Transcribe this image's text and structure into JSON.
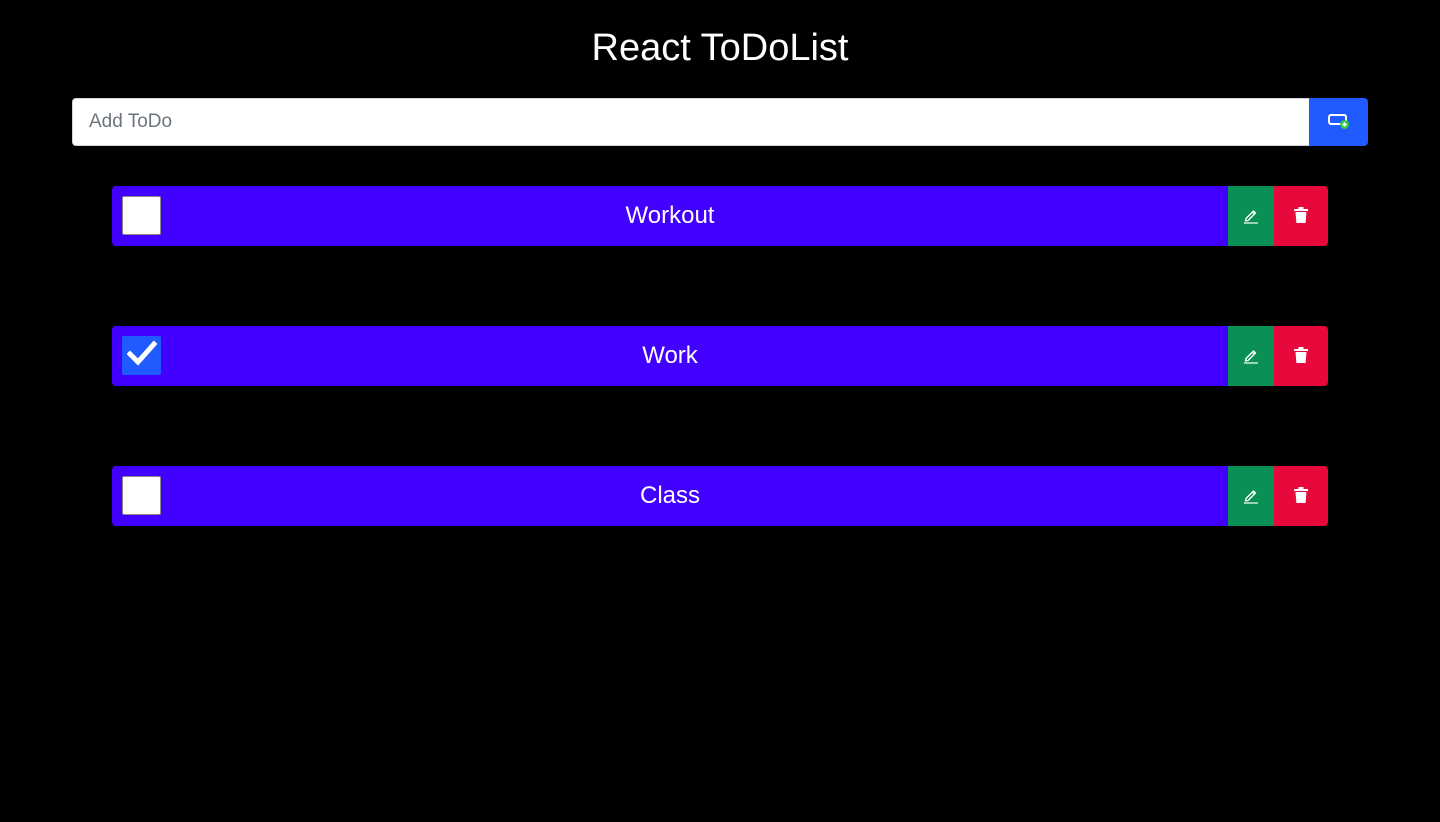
{
  "header": {
    "title": "React ToDoList"
  },
  "add_form": {
    "placeholder": "Add ToDo",
    "value": "",
    "button_icon": "add-task-icon"
  },
  "todos": [
    {
      "text": "Workout",
      "completed": false
    },
    {
      "text": "Work",
      "completed": true
    },
    {
      "text": "Class",
      "completed": false
    }
  ],
  "colors": {
    "background": "#000000",
    "todo_bar": "#4200ff",
    "add_button": "#1f5bff",
    "edit_button": "#0a8f55",
    "delete_button": "#e8083c",
    "checkbox_checked": "#1f5bff"
  },
  "icons": {
    "edit": "pencil-icon",
    "delete": "trash-icon",
    "check": "checkmark-icon"
  }
}
